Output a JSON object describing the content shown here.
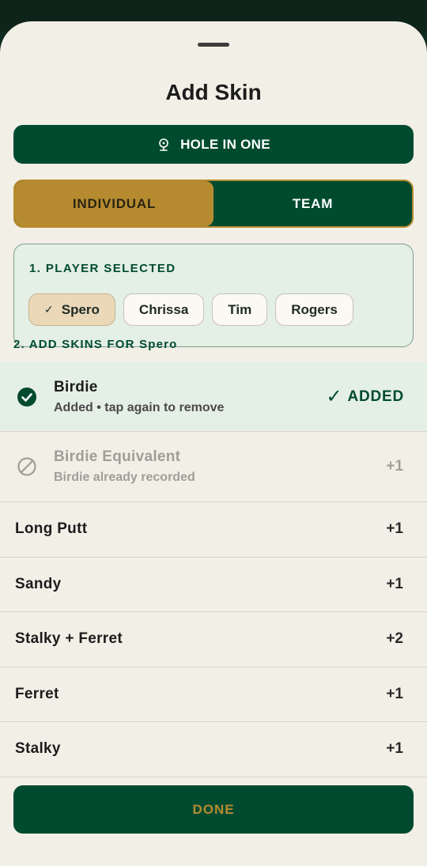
{
  "header": {
    "title": "Add Skin"
  },
  "hole_button": {
    "label": "HOLE IN ONE",
    "icon": "golf-pin-icon"
  },
  "mode_toggle": {
    "options": [
      "INDIVIDUAL",
      "TEAM"
    ],
    "selected": "INDIVIDUAL"
  },
  "player_section": {
    "label": "1. PLAYER SELECTED",
    "players": [
      {
        "name": "Spero",
        "selected": true
      },
      {
        "name": "Chrissa",
        "selected": false
      },
      {
        "name": "Tim",
        "selected": false
      },
      {
        "name": "Rogers",
        "selected": false
      }
    ]
  },
  "skins_section": {
    "label": "2. ADD SKINS FOR Spero"
  },
  "skins": [
    {
      "name": "Birdie",
      "subtitle": "Added • tap again to remove",
      "state": "added",
      "badge": "ADDED",
      "badge_icon": "✓"
    },
    {
      "name": "Birdie Equivalent",
      "subtitle": "Birdie already recorded",
      "state": "disabled",
      "value": "+1"
    },
    {
      "name": "Long Putt",
      "value": "+1",
      "state": "available"
    },
    {
      "name": "Sandy",
      "value": "+1",
      "state": "available"
    },
    {
      "name": "Stalky + Ferret",
      "value": "+2",
      "state": "available"
    },
    {
      "name": "Ferret",
      "value": "+1",
      "state": "available"
    },
    {
      "name": "Stalky",
      "value": "+1",
      "state": "available"
    }
  ],
  "done_button": {
    "label": "DONE"
  },
  "colors": {
    "primary_green": "#004b30",
    "gold": "#b68b2f",
    "background": "#f2efe6",
    "selected_tint": "#e4efe6"
  }
}
